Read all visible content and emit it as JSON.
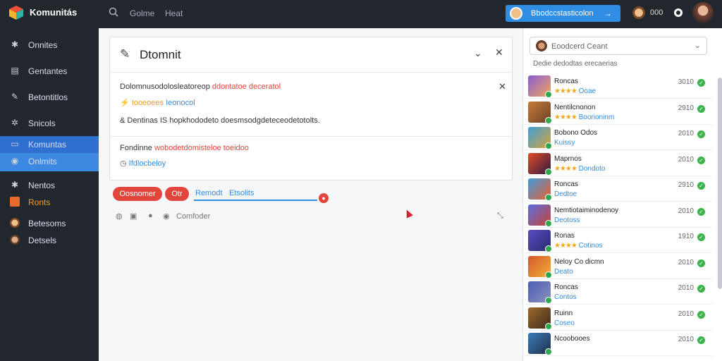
{
  "app": {
    "name": "Komunitás"
  },
  "topbar": {
    "search_icon": "search-icon",
    "links": [
      "Golme",
      "Heat"
    ],
    "primary_button": "Bbodccstasticolon",
    "user_count": "000"
  },
  "sidebar": {
    "items": [
      {
        "label": "Onnites",
        "icon": "gear-icon"
      },
      {
        "label": "Gentantes",
        "icon": "document-icon"
      },
      {
        "label": "Betontitlos",
        "icon": "wrench-icon"
      },
      {
        "label": "Snicols",
        "icon": "cog-icon"
      },
      {
        "label": "Komuntas",
        "icon": "comment-icon"
      },
      {
        "label": "Onlmits",
        "icon": "chat-icon"
      },
      {
        "label": "Nentos",
        "icon": "settings-icon"
      },
      {
        "label": "Ronts",
        "icon": "avatar-icon"
      },
      {
        "label": "Betesoms",
        "icon": "avatar-icon"
      },
      {
        "label": "Detsels",
        "icon": "avatar-icon"
      }
    ]
  },
  "card": {
    "title": "Dtomnit",
    "row1_prefix": "Dolomnusodolosleatoreop",
    "row1_red": "ddontatoe deceratol",
    "row2_orange": "Iooeoees",
    "row2_blue": "Ieonocol",
    "row3": "Dentinas IS hopkhododeto doesmsodgdeteceodetotolts.",
    "row4_prefix": "Fondinne",
    "row4_red": "wobodetdomisteloe toeidoo",
    "row5_blue": "Ifdlocbeloy"
  },
  "actions": {
    "btn1": "Oosnomer",
    "btn2": "Otr",
    "tab1": "Remodt",
    "tab2": "Etsolits",
    "status": "Comfoder"
  },
  "panel": {
    "dropdown_label": "Eoodcerd Ceant",
    "subtitle": "Dedie dedodtas erecaerias",
    "items": [
      {
        "name": "Roncas",
        "meta": "Ooae",
        "num": "3010",
        "colors": [
          "#8a5bd6",
          "#f0a75a"
        ]
      },
      {
        "name": "Nentilcnonon",
        "meta": "Boorioninm",
        "num": "2910",
        "colors": [
          "#c77d3b",
          "#6b4226"
        ]
      },
      {
        "name": "Bobono Odos",
        "meta": "Kuissy",
        "num": "2010",
        "colors": [
          "#3ca0d8",
          "#d9a23a"
        ]
      },
      {
        "name": "Maprnos",
        "meta": "Dondoto",
        "num": "2010",
        "colors": [
          "#e44b2a",
          "#2b1b3d"
        ]
      },
      {
        "name": "Roncas",
        "meta": "Dedtoe",
        "num": "2910",
        "colors": [
          "#3f9be0",
          "#e95f2c"
        ]
      },
      {
        "name": "Nemtiotaiminodenoy",
        "meta": "Deotoss",
        "num": "2010",
        "colors": [
          "#5b6ee8",
          "#c4452f"
        ]
      },
      {
        "name": "Ronas",
        "meta": "Cotinos",
        "num": "1910",
        "colors": [
          "#5a4cc9",
          "#2a2a6a"
        ]
      },
      {
        "name": "Neloy Co dicmn",
        "meta": "Deato",
        "num": "2010",
        "colors": [
          "#d6562a",
          "#f1b13c"
        ]
      },
      {
        "name": "Roncas",
        "meta": "Contos",
        "num": "2010",
        "colors": [
          "#4a5fb2",
          "#8a8fbf"
        ]
      },
      {
        "name": "Ruinn",
        "meta": "Coseo",
        "num": "2010",
        "colors": [
          "#9d6a2e",
          "#3d2a1a"
        ]
      },
      {
        "name": "Ncoobooes",
        "meta": "",
        "num": "2010",
        "colors": [
          "#3b7dba",
          "#1f2e4a"
        ]
      }
    ]
  },
  "colors": {
    "accent": "#2f8de4",
    "danger": "#e2453c",
    "sidebar": "#22272d"
  }
}
